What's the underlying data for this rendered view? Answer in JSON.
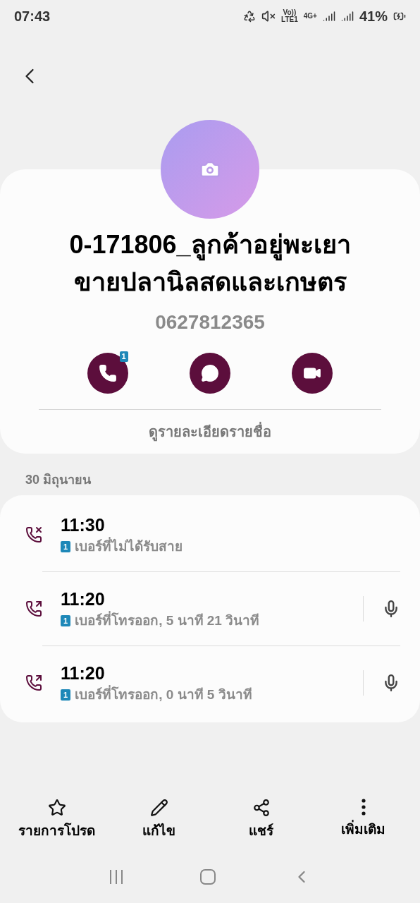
{
  "status_bar": {
    "time": "07:43",
    "network_top": "Vo))",
    "network_bottom": "LTE1",
    "data_type": "4G+",
    "battery": "41%"
  },
  "contact": {
    "name_lines": [
      "0-171806_ลูกค้าอยู่พะเยา",
      "ขายปลานิลสดและเกษตร"
    ],
    "phone": "0627812365",
    "call_badge": "1",
    "view_details": "ดูรายละเอียดรายชื่อ"
  },
  "log": {
    "date": "30 มิถุนายน",
    "entries": [
      {
        "kind": "missed",
        "time": "11:30",
        "sim": "1",
        "detail": "เบอร์ที่ไม่ได้รับสาย",
        "recording": false
      },
      {
        "kind": "outgoing",
        "time": "11:20",
        "sim": "1",
        "detail": "เบอร์ที่โทรออก, 5 นาที 21 วินาที",
        "recording": true
      },
      {
        "kind": "outgoing",
        "time": "11:20",
        "sim": "1",
        "detail": "เบอร์ที่โทรออก, 0 นาที 5 วินาที",
        "recording": true
      }
    ]
  },
  "bottom_actions": [
    {
      "kind": "favorite",
      "label": "รายการโปรด"
    },
    {
      "kind": "edit",
      "label": "แก้ไข"
    },
    {
      "kind": "share",
      "label": "แชร์"
    },
    {
      "kind": "more",
      "label": "เพิ่มเติม"
    }
  ]
}
